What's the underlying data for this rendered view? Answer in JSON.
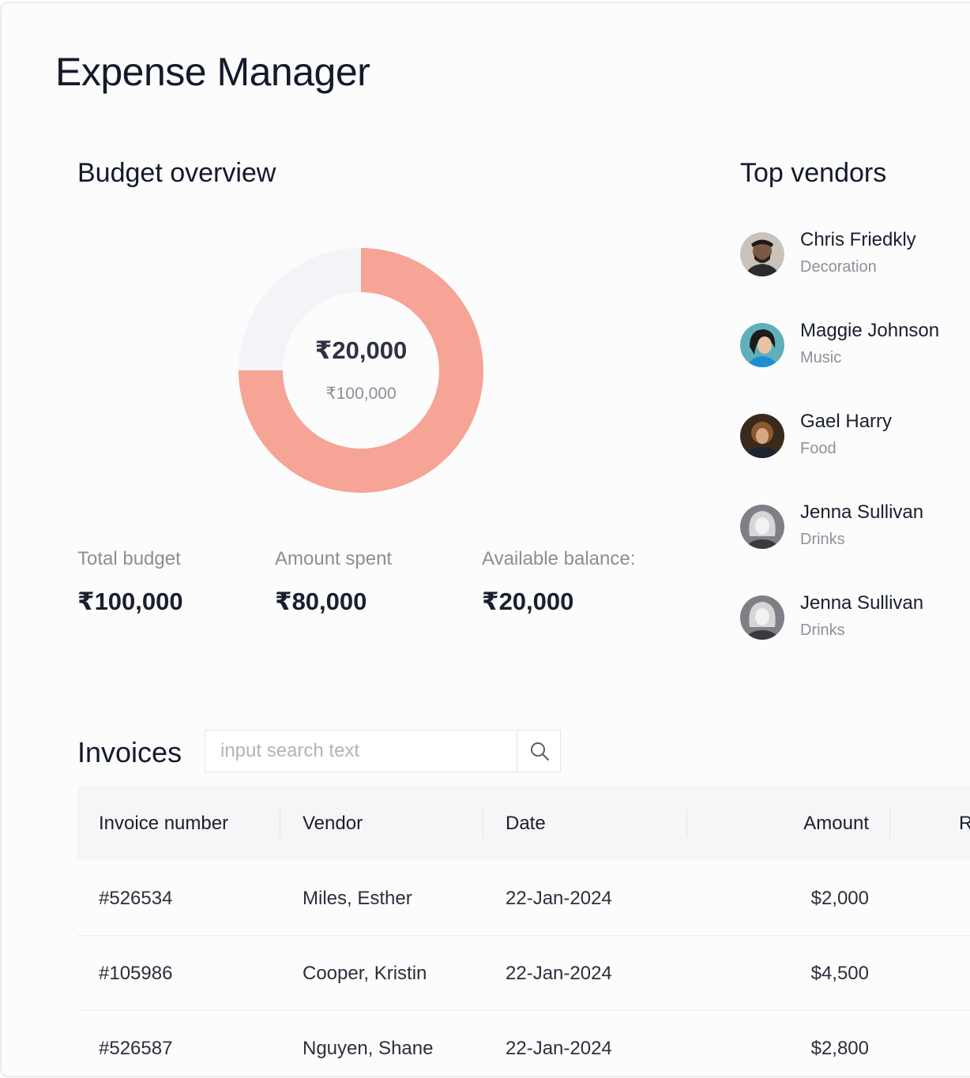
{
  "app": {
    "title": "Expense Manager"
  },
  "budget": {
    "title": "Budget overview",
    "donut": {
      "center_value": "₹20,000",
      "center_total": "₹100,000",
      "spent_fraction": 0.75,
      "spent_color": "#f5a496",
      "remaining_color": "#f3f4f8"
    },
    "stats": [
      {
        "label": "Total budget",
        "value": "₹100,000"
      },
      {
        "label": "Amount spent",
        "value": "₹80,000"
      },
      {
        "label": "Available balance:",
        "value": "₹20,000"
      }
    ]
  },
  "vendors": {
    "title": "Top vendors",
    "items": [
      {
        "name": "Chris Friedkly",
        "category": "Decoration",
        "avatar": "person-avatar-icon"
      },
      {
        "name": "Maggie Johnson",
        "category": "Music",
        "avatar": "person-avatar-icon"
      },
      {
        "name": "Gael Harry",
        "category": "Food",
        "avatar": "person-avatar-icon"
      },
      {
        "name": "Jenna Sullivan",
        "category": "Drinks",
        "avatar": "person-avatar-icon"
      },
      {
        "name": "Jenna Sullivan",
        "category": "Drinks",
        "avatar": "person-avatar-icon"
      }
    ]
  },
  "invoices": {
    "title": "Invoices",
    "search": {
      "placeholder": "input search text",
      "value": "",
      "icon": "search-icon"
    },
    "columns": [
      "Invoice number",
      "Vendor",
      "Date",
      "Amount",
      "R"
    ],
    "rows": [
      {
        "number": "#526534",
        "vendor": "Miles, Esther",
        "date": "22-Jan-2024",
        "amount": "$2,000"
      },
      {
        "number": "#105986",
        "vendor": "Cooper, Kristin",
        "date": "22-Jan-2024",
        "amount": "$4,500"
      },
      {
        "number": "#526587",
        "vendor": "Nguyen, Shane",
        "date": "22-Jan-2024",
        "amount": "$2,800"
      }
    ]
  }
}
